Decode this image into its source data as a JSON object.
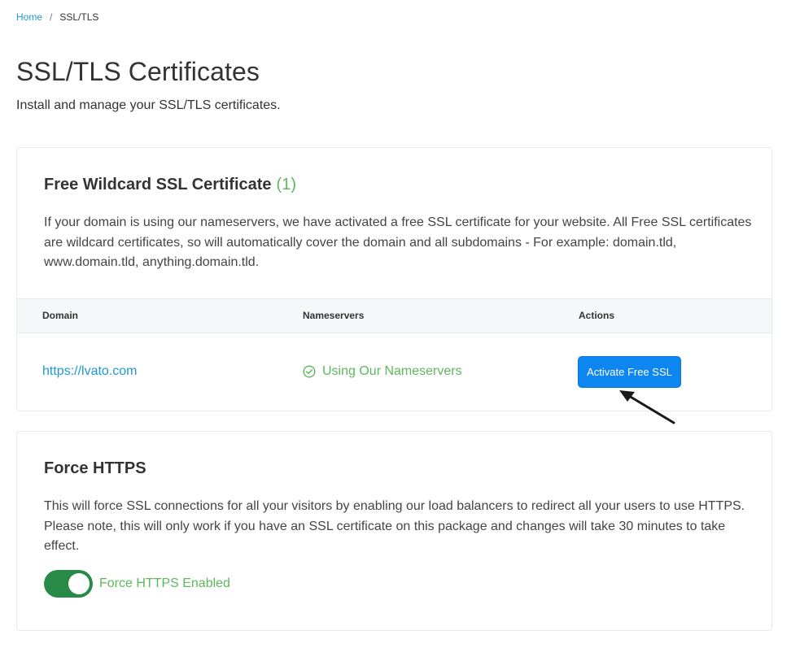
{
  "breadcrumb": {
    "home": "Home",
    "separator": "/",
    "current": "SSL/TLS"
  },
  "page": {
    "title": "SSL/TLS Certificates",
    "subtitle": "Install and manage your SSL/TLS certificates."
  },
  "wildcard_card": {
    "title": "Free Wildcard SSL Certificate",
    "count": "(1)",
    "description": "If your domain is using our nameservers, we have activated a free SSL certificate for your website. All Free SSL certificates are wildcard certificates, so will automatically cover the domain and all subdomains - For example: domain.tld, www.domain.tld, anything.domain.tld.",
    "table": {
      "headers": [
        "Domain",
        "Nameservers",
        "Actions"
      ],
      "rows": [
        {
          "domain": "https://lvato.com",
          "nameservers_status": "Using Our Nameservers",
          "nameservers_icon": "check-circle-icon",
          "action_label": "Activate Free SSL"
        }
      ]
    }
  },
  "https_card": {
    "title": "Force HTTPS",
    "description": "This will force SSL connections for all your visitors by enabling our load balancers to redirect all your users to use HTTPS. Please note, this will only work if you have an SSL certificate on this package and changes will take 30 minutes to take effect.",
    "toggle_label": "Force HTTPS Enabled",
    "toggle_on": true
  },
  "colors": {
    "link": "#1c9ad6",
    "success": "#5cb85c",
    "primary_button": "#0d86ef",
    "toggle_on": "#288a47"
  }
}
